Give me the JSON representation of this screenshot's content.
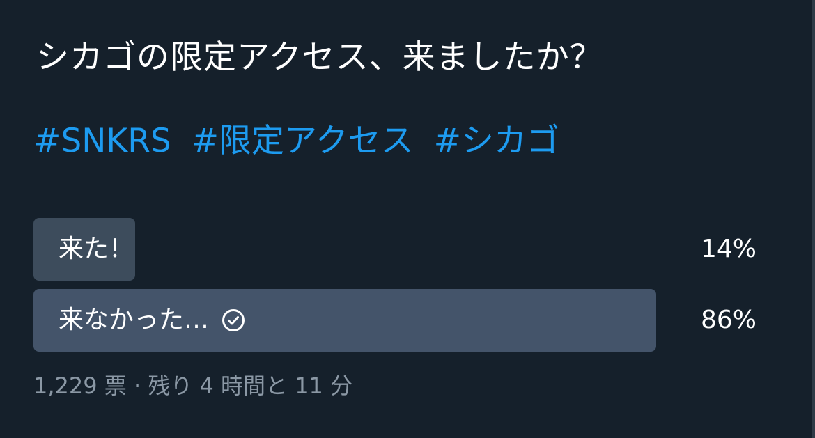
{
  "tweet": {
    "text": "シカゴの限定アクセス、来ましたか？",
    "hashtags": [
      "#SNKRS",
      "#限定アクセス",
      "#シカゴ"
    ]
  },
  "poll": {
    "options": [
      {
        "label": "来た！",
        "percent_text": "14%",
        "percent": 14,
        "selected": false
      },
      {
        "label": "来なかった…",
        "percent_text": "86%",
        "percent": 86,
        "selected": true
      }
    ],
    "votes": "1,229 票",
    "separator": "·",
    "time_left": "残り 4 時間と 11 分"
  },
  "colors": {
    "background": "#15202b",
    "text": "#ffffff",
    "hashtag": "#1d9bf0",
    "bar": "#3d4c5c",
    "muted": "#8b98a5"
  },
  "icons": {
    "selected_option": "check-circle-icon"
  }
}
